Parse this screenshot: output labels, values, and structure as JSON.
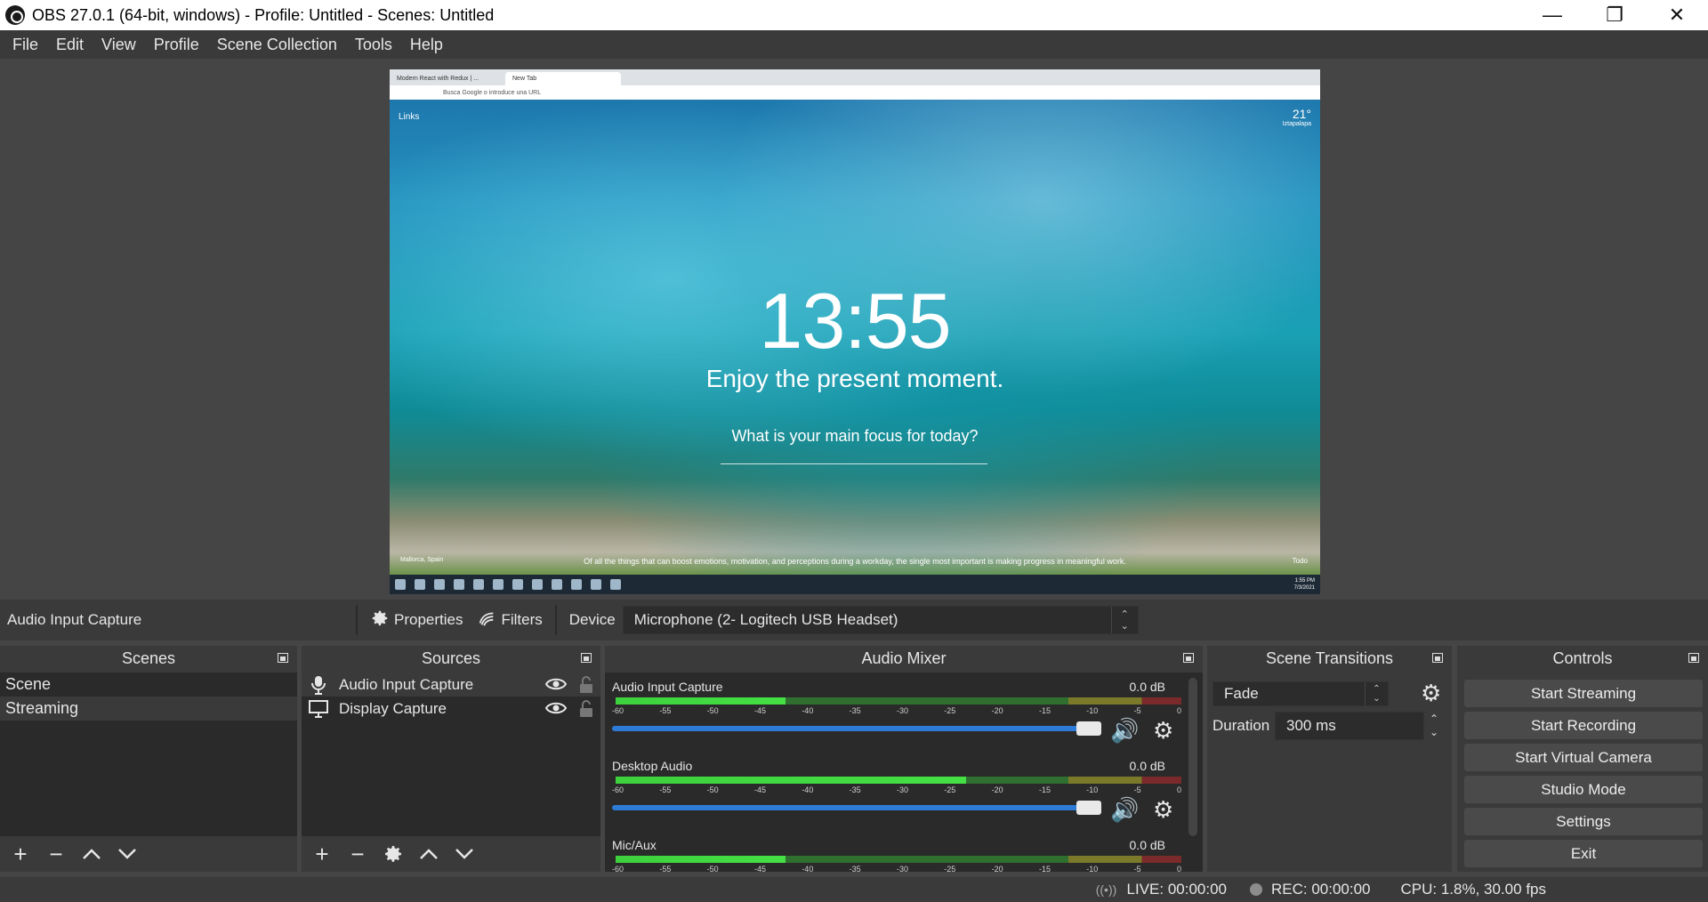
{
  "window": {
    "title": "OBS 27.0.1 (64-bit, windows) - Profile: Untitled - Scenes: Untitled",
    "minimize": "—",
    "restore": "❐",
    "close": "✕"
  },
  "menu": [
    "File",
    "Edit",
    "View",
    "Profile",
    "Scene Collection",
    "Tools",
    "Help"
  ],
  "preview": {
    "tab1": "Modern React with Redux | ...",
    "tab2": "New Tab",
    "address": "Busca Google o introduce una URL",
    "links": "Links",
    "weather_temp": "21°",
    "weather_loc": "Iztapalapa",
    "clock": "13:55",
    "greeting": "Enjoy the present moment.",
    "focus_question": "What is your main focus for today?",
    "quote": "Of all the things that can boost emotions, motivation, and perceptions during a workday, the single most important is making progress in meaningful work.",
    "photo_credit": "Mallorca, Spain",
    "todo": "Todo",
    "taskbar_time": "1:55 PM",
    "taskbar_date": "7/3/2021"
  },
  "context": {
    "source": "Audio Input Capture",
    "properties": "Properties",
    "filters": "Filters",
    "device_label": "Device",
    "device_value": "Microphone (2- Logitech USB Headset)"
  },
  "scenes": {
    "title": "Scenes",
    "items": [
      "Scene",
      "Streaming"
    ]
  },
  "sources": {
    "title": "Sources",
    "items": [
      "Audio Input Capture",
      "Display Capture"
    ]
  },
  "mixer": {
    "title": "Audio Mixer",
    "scale": [
      "-60",
      "-55",
      "-50",
      "-45",
      "-40",
      "-35",
      "-30",
      "-25",
      "-20",
      "-15",
      "-10",
      "-5",
      "0"
    ],
    "channels": [
      {
        "name": "Audio Input Capture",
        "db": "0.0 dB",
        "level": 0.3,
        "volume": 1.0
      },
      {
        "name": "Desktop Audio",
        "db": "0.0 dB",
        "level": 0.62,
        "volume": 1.0
      },
      {
        "name": "Mic/Aux",
        "db": "0.0 dB",
        "level": 0.3,
        "volume": 1.0
      }
    ]
  },
  "transitions": {
    "title": "Scene Transitions",
    "type": "Fade",
    "duration_label": "Duration",
    "duration": "300 ms"
  },
  "controls": {
    "title": "Controls",
    "buttons": [
      "Start Streaming",
      "Start Recording",
      "Start Virtual Camera",
      "Studio Mode",
      "Settings",
      "Exit"
    ]
  },
  "status": {
    "live": "LIVE: 00:00:00",
    "rec": "REC: 00:00:00",
    "cpu": "CPU: 1.8%, 30.00 fps"
  }
}
